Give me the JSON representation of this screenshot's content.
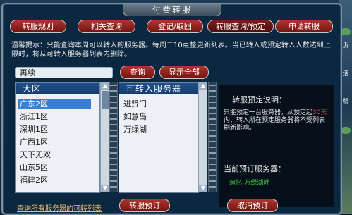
{
  "window": {
    "title": "付费转服"
  },
  "tabs": [
    {
      "label": "转服规则",
      "active": false
    },
    {
      "label": "相关查询",
      "active": false
    },
    {
      "label": "登记/取回",
      "active": false
    },
    {
      "label": "转服查询/预定",
      "active": true
    },
    {
      "label": "申请转服",
      "active": false
    }
  ],
  "notice": "温馨提示：只能查询本周可以转入的服务器。每周二10点整更新列表。当已转入或预定转入人数达到上限时，将从可转入服务器列表内删除。",
  "search": {
    "value": "再续",
    "query_label": "查询",
    "show_all_label": "显示全部"
  },
  "region_list": {
    "header": "大区",
    "items": [
      "广东2区",
      "浙江1区",
      "深圳1区",
      "广西1区",
      "天下无双",
      "山东5区",
      "福建2区"
    ],
    "selected_index": 0
  },
  "server_list": {
    "header": "可转入服务器",
    "items": [
      "进贤门",
      "如意岛",
      "万绿湖"
    ]
  },
  "info": {
    "title": "转服预定说明：",
    "text_before": "只能预定一台服务器，从预定起",
    "text_red": "30天",
    "text_after": "内，转入所在预定服务器将不受列表刷新影响。",
    "current_label": "当前预订服务器：",
    "current_value": "追忆-万绿湖畔"
  },
  "bottom": {
    "link_label": "查询所有服务器的可转列表",
    "transfer_button": "转服预订",
    "cancel_button": "取消预订"
  },
  "side_text": [
    "沂",
    "洁",
    "盟"
  ]
}
